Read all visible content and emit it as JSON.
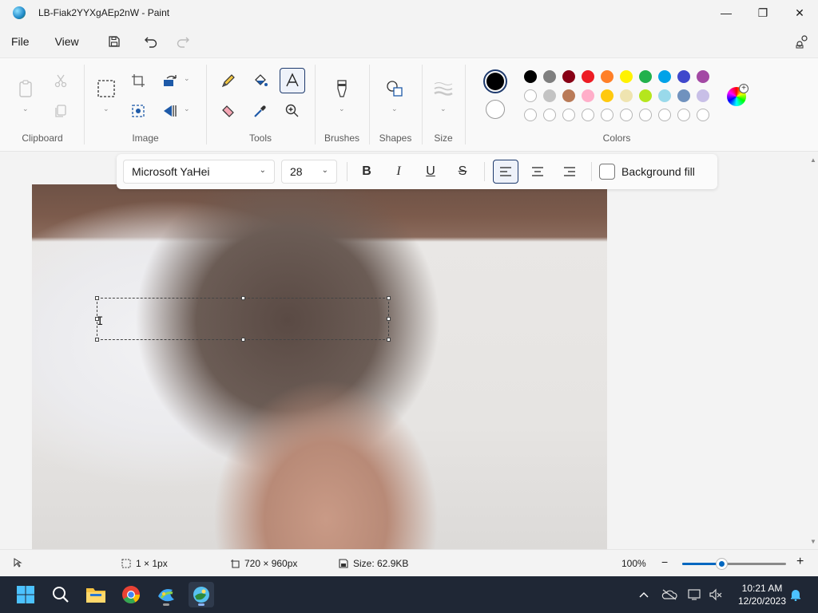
{
  "window": {
    "title": "LB-Fiak2YYXgAEp2nW - Paint",
    "minimize_glyph": "—",
    "maximize_glyph": "❐",
    "close_glyph": "✕"
  },
  "menu": {
    "file": "File",
    "view": "View"
  },
  "ribbon": {
    "clipboard": {
      "label": "Clipboard"
    },
    "image": {
      "label": "Image"
    },
    "tools": {
      "label": "Tools"
    },
    "brushes": {
      "label": "Brushes"
    },
    "shapes": {
      "label": "Shapes"
    },
    "size": {
      "label": "Size"
    },
    "colors": {
      "label": "Colors",
      "primary": "#000000",
      "secondary": "#ffffff",
      "row1": [
        "#000000",
        "#7f7f7f",
        "#880015",
        "#ed1c24",
        "#ff7f27",
        "#fff200",
        "#22b14c",
        "#00a2e8",
        "#3f48cc",
        "#a349a4"
      ],
      "row2": [
        "#ffffff",
        "#c3c3c3",
        "#b97a57",
        "#ffaec9",
        "#ffc90e",
        "#efe4b0",
        "#b5e61d",
        "#99d9ea",
        "#7092be",
        "#c8bfe7"
      ],
      "row3_empty_count": 10
    }
  },
  "text_toolbar": {
    "font": "Microsoft YaHei",
    "size": "28",
    "bold_glyph": "B",
    "italic_glyph": "I",
    "underline_glyph": "U",
    "strike_glyph": "S",
    "background_fill": "Background fill",
    "background_fill_checked": false,
    "alignment": "left"
  },
  "canvas": {
    "ibeam_glyph": "I"
  },
  "status": {
    "selection": "1 × 1px",
    "canvas_size": "720 × 960px",
    "file_size": "Size: 62.9KB",
    "zoom": "100%",
    "zoom_level": 0.38
  },
  "taskbar": {
    "time": "10:21 AM",
    "date": "12/20/2023"
  }
}
